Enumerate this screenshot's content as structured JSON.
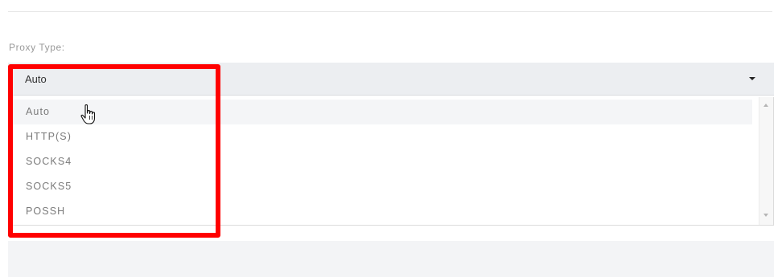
{
  "proxy": {
    "label": "Proxy Type:",
    "selected": "Auto",
    "options": [
      "Auto",
      "HTTP(S)",
      "SOCKS4",
      "SOCKS5",
      "POSSH"
    ],
    "hovered_option": "Auto"
  },
  "colors": {
    "highlight": "#ff0000",
    "select_bg": "#eceef1",
    "option_text": "#7a7a7a"
  },
  "icons": {
    "caret": "caret-down-icon",
    "cursor": "hand-cursor-icon",
    "scroll_up": "scroll-up-icon",
    "scroll_down": "scroll-down-icon"
  }
}
